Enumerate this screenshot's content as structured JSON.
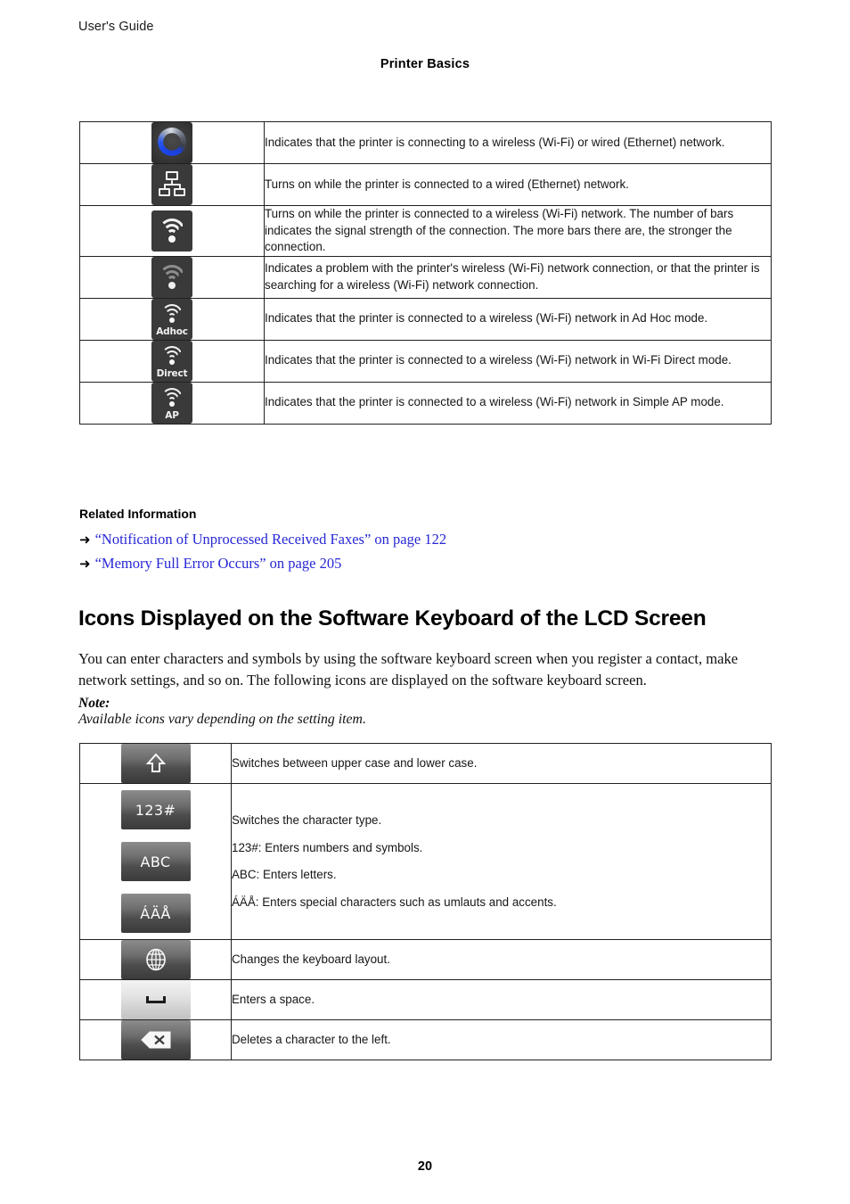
{
  "header": {
    "guide_label": "User's Guide",
    "section_title": "Printer Basics"
  },
  "network_icons_table": {
    "rows": [
      {
        "icon": "network-connecting-icon",
        "icon_label": "",
        "description": "Indicates that the printer is connecting to a wireless (Wi-Fi) or wired (Ethernet) network."
      },
      {
        "icon": "ethernet-icon",
        "icon_label": "",
        "description": "Turns on while the printer is connected to a wired (Ethernet) network."
      },
      {
        "icon": "wifi-signal-icon",
        "icon_label": "",
        "description": "Turns on while the printer is connected to a wireless (Wi-Fi) network. The number of bars indicates the signal strength of the connection. The more bars there are, the stronger the connection."
      },
      {
        "icon": "wifi-problem-icon",
        "icon_label": "",
        "description": "Indicates a problem with the printer's wireless (Wi-Fi) network connection, or that the printer is searching for a wireless (Wi-Fi) network connection."
      },
      {
        "icon": "wifi-adhoc-icon",
        "icon_label": "Adhoc",
        "description": "Indicates that the printer is connected to a wireless (Wi-Fi) network in Ad Hoc mode."
      },
      {
        "icon": "wifi-direct-icon",
        "icon_label": "Direct",
        "description": "Indicates that the printer is connected to a wireless (Wi-Fi) network in Wi-Fi Direct mode."
      },
      {
        "icon": "wifi-simple-ap-icon",
        "icon_label": "AP",
        "description": "Indicates that the printer is connected to a wireless (Wi-Fi) network in Simple AP mode."
      }
    ]
  },
  "related_information": {
    "heading": "Related Information",
    "links": [
      {
        "text": "“Notification of Unprocessed Received Faxes” on page 122",
        "arrow": "➜"
      },
      {
        "text": "“Memory Full Error Occurs” on page 205",
        "arrow": "➜"
      }
    ]
  },
  "keyboard_section": {
    "heading": "Icons Displayed on the Software Keyboard of the LCD Screen",
    "intro": "You can enter characters and symbols by using the software keyboard screen when you register a contact, make network settings, and so on. The following icons are displayed on the software keyboard screen.",
    "note_label": "Note:",
    "note_text": "Available icons vary depending on the setting item."
  },
  "keyboard_icons_table": {
    "rows": [
      {
        "icons": [
          {
            "name": "shift-key-icon",
            "label": ""
          }
        ],
        "lines": [
          "Switches between upper case and lower case."
        ]
      },
      {
        "icons": [
          {
            "name": "numbers-symbols-key-icon",
            "label": "123#"
          },
          {
            "name": "letters-key-icon",
            "label": "ABC"
          },
          {
            "name": "accents-key-icon",
            "label": "ÁÄÅ"
          }
        ],
        "lines": [
          "Switches the character type.",
          "123#: Enters numbers and symbols.",
          "ABC: Enters letters.",
          "ÁÄÅ: Enters special characters such as umlauts and accents."
        ]
      },
      {
        "icons": [
          {
            "name": "keyboard-layout-globe-key-icon",
            "label": ""
          }
        ],
        "lines": [
          "Changes the keyboard layout."
        ]
      },
      {
        "icons": [
          {
            "name": "space-key-icon",
            "label": ""
          }
        ],
        "lines": [
          "Enters a space."
        ]
      },
      {
        "icons": [
          {
            "name": "backspace-key-icon",
            "label": ""
          }
        ],
        "lines": [
          "Deletes a character to the left."
        ]
      }
    ]
  },
  "footer": {
    "page_number": "20"
  },
  "colors": {
    "link": "#2727d6",
    "lcd_tile": "#3a3a3a",
    "spinner_blue": "#1b46e8",
    "text": "#111111"
  }
}
